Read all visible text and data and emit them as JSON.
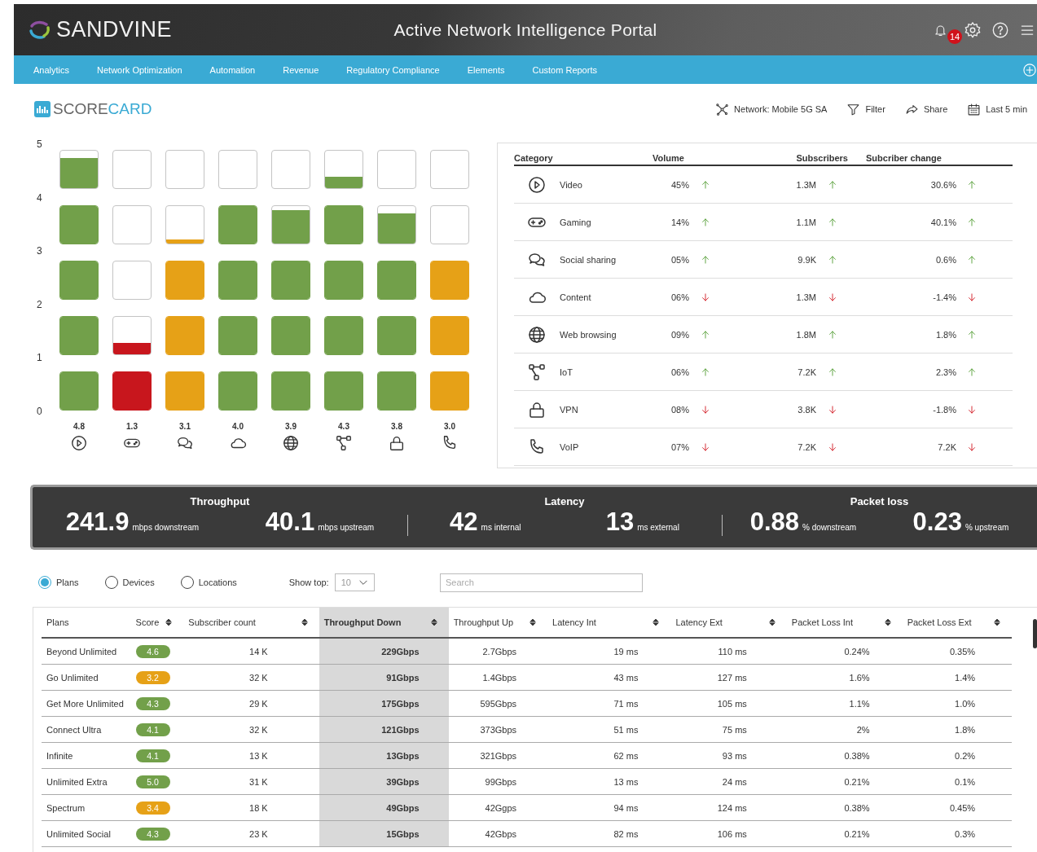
{
  "header": {
    "logo": "SANDVINE",
    "title": "Active Network Intelligence Portal",
    "notification_count": "14"
  },
  "nav": {
    "items": [
      "Analytics",
      "Network Optimization",
      "Automation",
      "Revenue",
      "Regulatory Compliance",
      "Elements",
      "Custom Reports"
    ]
  },
  "scorecard": {
    "title_start": "SCORE",
    "title_end": "CARD",
    "toolbar": [
      "Network: Mobile 5G SA",
      "Filter",
      "Share",
      "Last 5 min"
    ],
    "y_labels": [
      "5",
      "4",
      "3",
      "2",
      "1",
      "0"
    ],
    "columns": [
      {
        "score": "4.8",
        "color": "#72a04a"
      },
      {
        "score": "1.3",
        "color": "#c8161d"
      },
      {
        "score": "3.1",
        "color": "#e6a117"
      },
      {
        "score": "4.0",
        "color": "#72a04a"
      },
      {
        "score": "3.9",
        "color": "#72a04a"
      },
      {
        "score": "4.3",
        "color": "#72a04a"
      },
      {
        "score": "3.8",
        "color": "#72a04a"
      },
      {
        "score": "3.0",
        "color": "#e6a117"
      }
    ]
  },
  "categories": {
    "headers": [
      "Category",
      "Volume",
      "Subscribers",
      "Subcriber change"
    ],
    "rows": [
      {
        "name": "Video",
        "volume": "45%",
        "volume_up": true,
        "subscribers": "1.3M",
        "subscribers_up": true,
        "change": "30.6%",
        "change_up": true
      },
      {
        "name": "Gaming",
        "volume": "14%",
        "volume_up": true,
        "subscribers": "1.1M",
        "subscribers_up": true,
        "change": "40.1%",
        "change_up": true
      },
      {
        "name": "Social sharing",
        "volume": "05%",
        "volume_up": true,
        "subscribers": "9.9K",
        "subscribers_up": true,
        "change": "0.6%",
        "change_up": true
      },
      {
        "name": "Content",
        "volume": "06%",
        "volume_up": false,
        "subscribers": "1.3M",
        "subscribers_up": false,
        "change": "-1.4%",
        "change_up": false
      },
      {
        "name": "Web browsing",
        "volume": "09%",
        "volume_up": true,
        "subscribers": "1.8M",
        "subscribers_up": true,
        "change": "1.8%",
        "change_up": true
      },
      {
        "name": "IoT",
        "volume": "06%",
        "volume_up": true,
        "subscribers": "7.2K",
        "subscribers_up": true,
        "change": "2.3%",
        "change_up": true
      },
      {
        "name": "VPN",
        "volume": "08%",
        "volume_up": false,
        "subscribers": "3.8K",
        "subscribers_up": false,
        "change": "-1.8%",
        "change_up": false
      },
      {
        "name": "VoIP",
        "volume": "07%",
        "volume_up": false,
        "subscribers": "7.2K",
        "subscribers_up": false,
        "change": "7.2K",
        "change_up": false
      }
    ]
  },
  "metrics": [
    {
      "title": "Throughput",
      "items": [
        {
          "value": "241.9",
          "unit": "mbps downstream"
        },
        {
          "value": "40.1",
          "unit": "mbps upstream"
        }
      ]
    },
    {
      "title": "Latency",
      "items": [
        {
          "value": "42",
          "unit": "ms internal"
        },
        {
          "value": "13",
          "unit": "ms external"
        }
      ]
    },
    {
      "title": "Packet loss",
      "items": [
        {
          "value": "0.88",
          "unit": "% downstream"
        },
        {
          "value": "0.23",
          "unit": "% upstream"
        }
      ]
    }
  ],
  "filters": {
    "views": [
      {
        "label": "Plans",
        "selected": true
      },
      {
        "label": "Devices",
        "selected": false
      },
      {
        "label": "Locations",
        "selected": false
      }
    ],
    "show_top": {
      "label": "Show top:",
      "value": "10"
    },
    "search": {
      "placeholder": "Search"
    }
  },
  "plans_table": {
    "columns": [
      {
        "label": "Plans",
        "sortable": false,
        "selected": false
      },
      {
        "label": "Score",
        "sortable": true,
        "selected": false
      },
      {
        "label": "Subscriber count",
        "sortable": true,
        "selected": false
      },
      {
        "label": "Throughput Down",
        "sortable": true,
        "selected": true
      },
      {
        "label": "Throughput Up",
        "sortable": true,
        "selected": false
      },
      {
        "label": "Latency Int",
        "sortable": true,
        "selected": false
      },
      {
        "label": "Latency Ext",
        "sortable": true,
        "selected": false
      },
      {
        "label": "Packet Loss Int",
        "sortable": true,
        "selected": false
      },
      {
        "label": "Packet Loss Ext",
        "sortable": true,
        "selected": false
      }
    ],
    "rows": [
      {
        "color": "#72a04a",
        "cells": [
          "Beyond Unlimited",
          "4.6",
          "14 K",
          "229Gbps",
          "2.7Gbps",
          "19 ms",
          "110 ms",
          "0.24%",
          "0.35%"
        ]
      },
      {
        "color": "#e6a117",
        "cells": [
          "Go Unlimited",
          "3.2",
          "32 K",
          "91Gbps",
          "1.4Gbps",
          "43 ms",
          "127 ms",
          "1.6%",
          "1.4%"
        ]
      },
      {
        "color": "#72a04a",
        "cells": [
          "Get More Unlimited",
          "4.3",
          "29 K",
          "175Gbps",
          "595Gbps",
          "71 ms",
          "105 ms",
          "1.1%",
          "1.0%"
        ]
      },
      {
        "color": "#72a04a",
        "cells": [
          "Connect Ultra",
          "4.1",
          "32 K",
          "121Gbps",
          "373Gbps",
          "51 ms",
          "75 ms",
          "2%",
          "1.8%"
        ]
      },
      {
        "color": "#72a04a",
        "cells": [
          "Infinite",
          "4.1",
          "13 K",
          "13Gbps",
          "321Gbps",
          "62 ms",
          "93 ms",
          "0.38%",
          "0.2%"
        ]
      },
      {
        "color": "#72a04a",
        "cells": [
          "Unlimited Extra",
          "5.0",
          "31 K",
          "39Gbps",
          "99Gbps",
          "13 ms",
          "24 ms",
          "0.21%",
          "0.1%"
        ]
      },
      {
        "color": "#e6a117",
        "cells": [
          "Spectrum",
          "3.4",
          "18 K",
          "49Gbps",
          "42Ggps",
          "94 ms",
          "124 ms",
          "0.38%",
          "0.45%"
        ]
      },
      {
        "color": "#72a04a",
        "cells": [
          "Unlimited Social",
          "4.3",
          "23 K",
          "15Gbps",
          "42Gbps",
          "82 ms",
          "106 ms",
          "0.21%",
          "0.3%"
        ]
      }
    ]
  }
}
